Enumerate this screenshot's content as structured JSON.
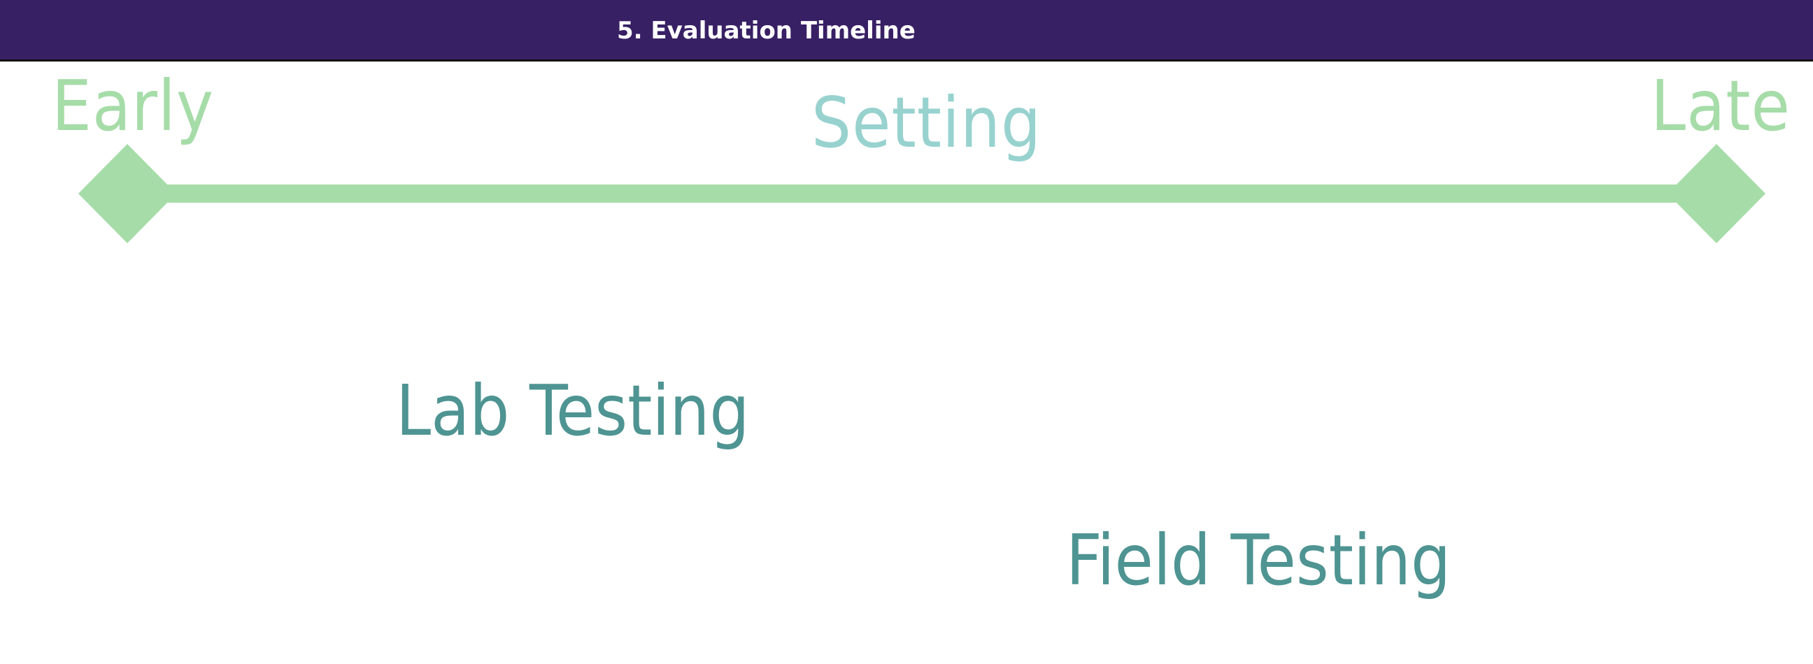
{
  "header": {
    "title": "5. Evaluation Timeline"
  },
  "timeline": {
    "start_label": "Early",
    "end_label": "Late",
    "axis_label": "Setting",
    "stages": [
      {
        "label": "Lab Testing"
      },
      {
        "label": "Field Testing"
      }
    ]
  },
  "colors": {
    "header_background": "#382064",
    "header_text": "#ffffff",
    "timeline_line": "#a6dca8",
    "axis_label": "#98d2cf",
    "stage_text": "#4e9492"
  }
}
